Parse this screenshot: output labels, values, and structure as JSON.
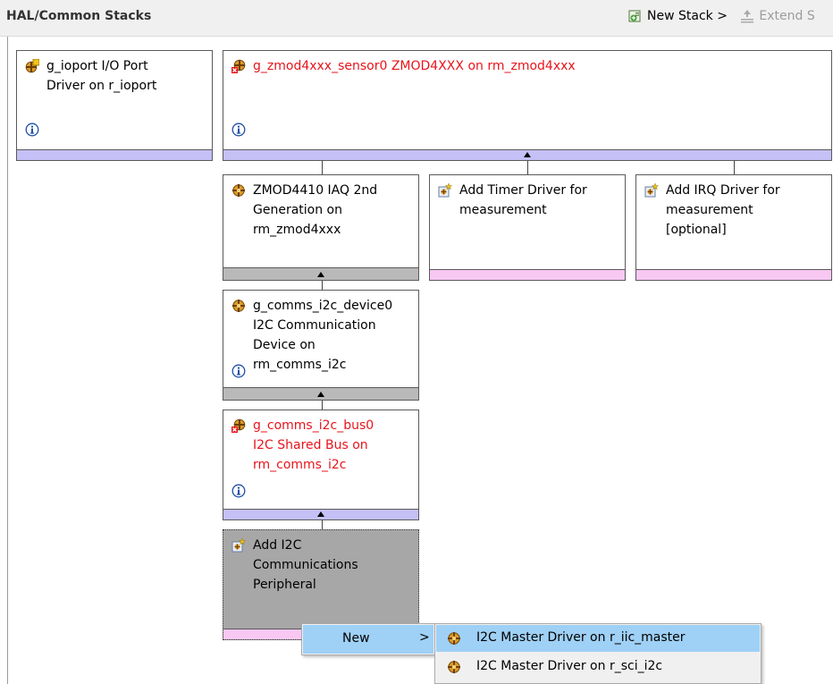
{
  "header": {
    "title": "HAL/Common Stacks",
    "new_stack": "New Stack >",
    "extend_stack": "Extend S"
  },
  "boxes": {
    "ioport": {
      "line1": "g_ioport I/O Port",
      "line2": "Driver on r_ioport"
    },
    "sensor": {
      "line1": "g_zmod4xxx_sensor0 ZMOD4XXX on rm_zmod4xxx"
    },
    "iaq": {
      "line1": "ZMOD4410 IAQ 2nd",
      "line2": "Generation on",
      "line3": "rm_zmod4xxx"
    },
    "timer": {
      "line1": "Add Timer Driver for",
      "line2": "measurement"
    },
    "irq": {
      "line1": "Add IRQ Driver for",
      "line2": "measurement",
      "line3": "[optional]"
    },
    "i2c_device": {
      "line1": "g_comms_i2c_device0",
      "line2": "I2C Communication",
      "line3": "Device on",
      "line4": "rm_comms_i2c"
    },
    "i2c_bus": {
      "line1": "g_comms_i2c_bus0",
      "line2": "I2C Shared Bus on",
      "line3": "rm_comms_i2c"
    },
    "add_i2c": {
      "line1": "Add I2C",
      "line2": "Communications",
      "line3": "Peripheral"
    }
  },
  "context_menu": {
    "new_label": "New",
    "new_arrow": ">",
    "items": [
      "I2C Master Driver on r_iic_master",
      "I2C Master Driver on r_sci_i2c"
    ]
  },
  "colors": {
    "error_text": "#e8141b",
    "bar_purple": "#c5c0f5",
    "bar_pink": "#f8c8f2",
    "bar_gray": "#b9b9b9",
    "menu_highlight": "#9fd0f5"
  }
}
